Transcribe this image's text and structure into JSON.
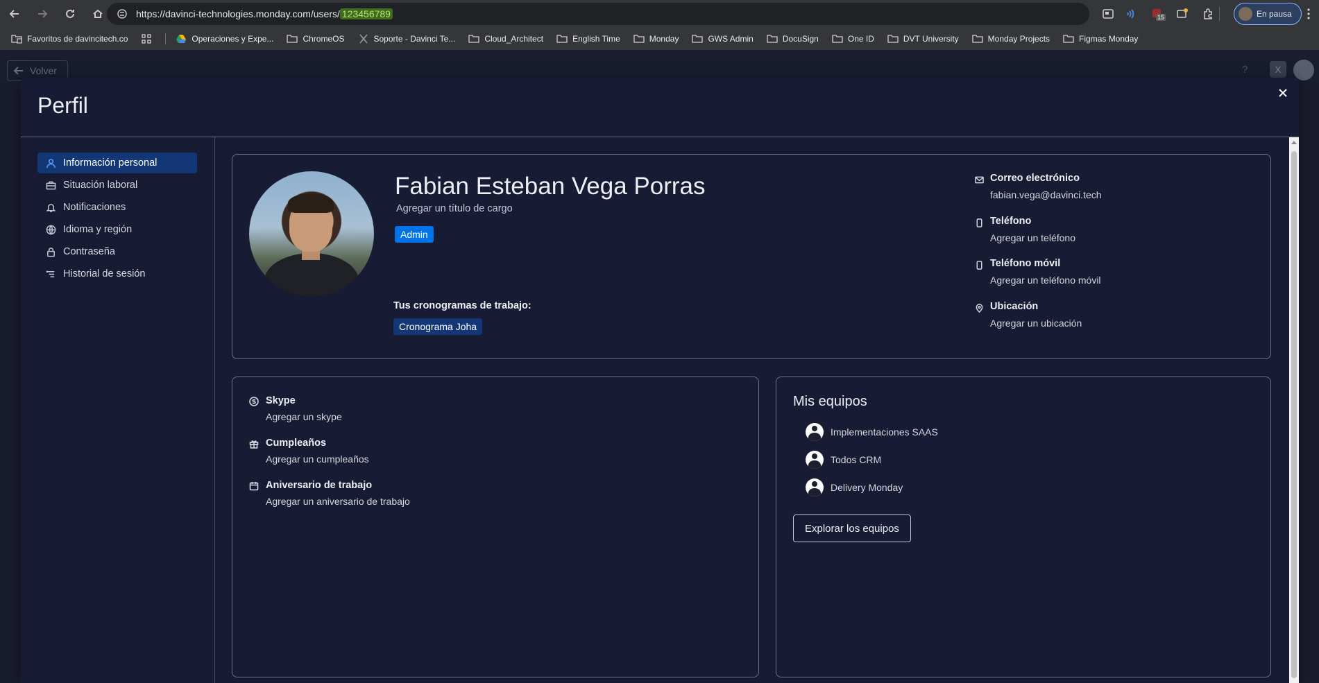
{
  "browser": {
    "url_prefix": "https://davinci-technologies.monday.com/users/",
    "url_id": "123456789",
    "pause_label": "En pausa",
    "ext_badge": "15",
    "bookmarks": [
      "Favoritos de davincitech.co",
      "Operaciones y Expe...",
      "ChromeOS",
      "Soporte - Davinci Te...",
      "Cloud_Architect",
      "English Time",
      "Monday",
      "GWS Admin",
      "DocuSign",
      "One ID",
      "DVT University",
      "Monday Projects",
      "Figmas Monday"
    ]
  },
  "page": {
    "back_label": "Volver",
    "help_label": "?"
  },
  "modal": {
    "title": "Perfil",
    "sidebar": [
      {
        "label": "Información personal",
        "icon": "person-icon",
        "active": true
      },
      {
        "label": "Situación laboral",
        "icon": "briefcase-icon"
      },
      {
        "label": "Notificaciones",
        "icon": "bell-icon"
      },
      {
        "label": "Idioma y región",
        "icon": "globe-icon"
      },
      {
        "label": "Contraseña",
        "icon": "lock-icon"
      },
      {
        "label": "Historial de sesión",
        "icon": "history-icon"
      }
    ],
    "profile": {
      "name": "Fabian Esteban Vega Porras",
      "job_title": "Agregar un título de cargo",
      "role_badge": "Admin",
      "schedules_label": "Tus cronogramas de trabajo:",
      "schedule": "Cronograma Joha",
      "contacts": [
        {
          "label": "Correo electrónico",
          "value": "fabian.vega@davinci.tech",
          "icon": "mail-icon"
        },
        {
          "label": "Teléfono",
          "value": "Agregar un teléfono",
          "icon": "phone-icon"
        },
        {
          "label": "Teléfono móvil",
          "value": "Agregar un teléfono móvil",
          "icon": "mobile-icon"
        },
        {
          "label": "Ubicación",
          "value": "Agregar un ubicación",
          "icon": "location-icon"
        }
      ]
    },
    "info": [
      {
        "label": "Skype",
        "value": "Agregar un skype",
        "icon": "skype-icon"
      },
      {
        "label": "Cumpleaños",
        "value": "Agregar un cumpleaños",
        "icon": "gift-icon"
      },
      {
        "label": "Aniversario de trabajo",
        "value": "Agregar un aniversario de trabajo",
        "icon": "calendar-icon"
      }
    ],
    "teams": {
      "title": "Mis equipos",
      "items": [
        "Implementaciones SAAS",
        "Todos CRM",
        "Delivery Monday"
      ],
      "explore_label": "Explorar los equipos"
    }
  },
  "colors": {
    "modal_bg": "#181b34",
    "accent": "#0073ea",
    "active_nav": "#133774"
  }
}
